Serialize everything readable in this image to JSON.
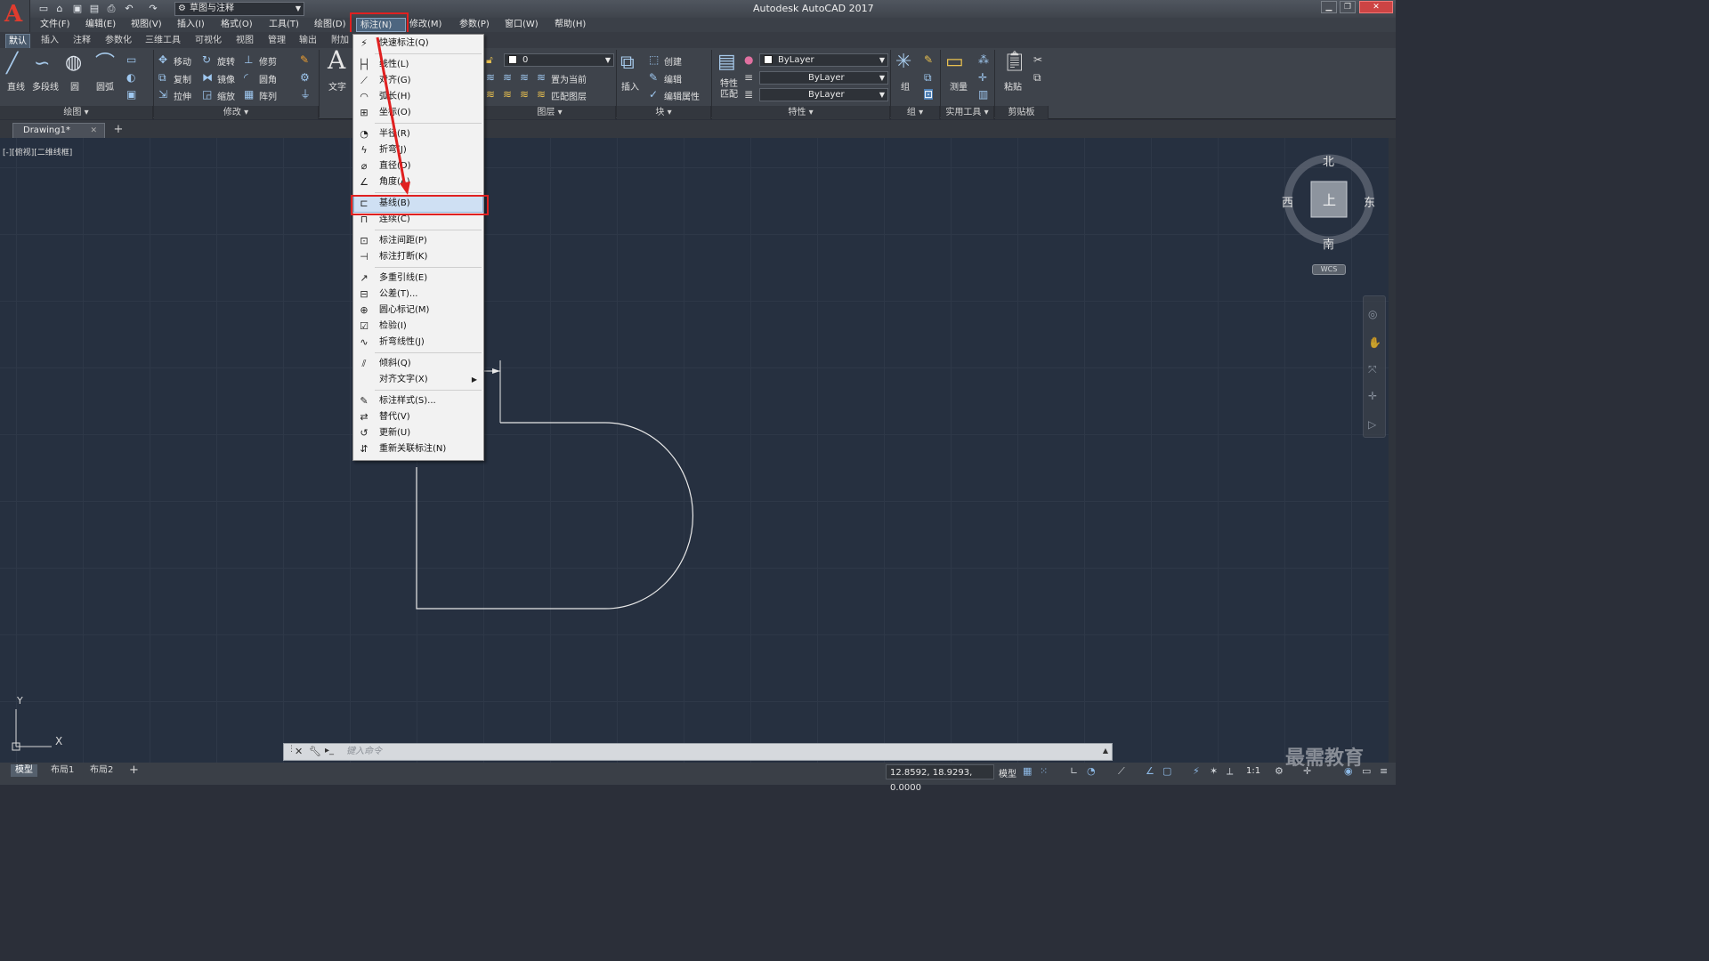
{
  "app": {
    "title": "Autodesk AutoCAD 2017",
    "workspace": "草图与注释"
  },
  "menubar": [
    {
      "id": "file",
      "label": "文件(F)"
    },
    {
      "id": "edit",
      "label": "编辑(E)"
    },
    {
      "id": "view",
      "label": "视图(V)"
    },
    {
      "id": "insert",
      "label": "插入(I)"
    },
    {
      "id": "format",
      "label": "格式(O)"
    },
    {
      "id": "tools",
      "label": "工具(T)"
    },
    {
      "id": "draw",
      "label": "绘图(D)"
    },
    {
      "id": "dimension",
      "label": "标注(N)"
    },
    {
      "id": "modify",
      "label": "修改(M)"
    },
    {
      "id": "parameters",
      "label": "参数(P)"
    },
    {
      "id": "window",
      "label": "窗口(W)"
    },
    {
      "id": "help",
      "label": "帮助(H)"
    }
  ],
  "ribbon_tabs": [
    "默认",
    "插入",
    "注释",
    "参数化",
    "三维工具",
    "可视化",
    "视图",
    "管理",
    "输出",
    "附加"
  ],
  "ribbon": {
    "draw": {
      "line": "直线",
      "polyline": "多段线",
      "circle": "圆",
      "arc": "圆弧",
      "panel": "绘图"
    },
    "modify": {
      "move": "移动",
      "rotate": "旋转",
      "trim": "修剪",
      "copy": "复制",
      "mirror": "镜像",
      "fillet": "圆角",
      "stretch": "拉伸",
      "scale": "缩放",
      "array": "阵列",
      "panel": "修改"
    },
    "annotation": {
      "text": "文字"
    },
    "layers": {
      "layer_value": "0",
      "set_current": "置为当前",
      "match_layer": "匹配图层",
      "panel": "图层"
    },
    "block": {
      "insert": "插入",
      "create": "创建",
      "edit": "编辑",
      "edit_attributes": "编辑属性",
      "panel": "块"
    },
    "properties": {
      "match_properties": "特性\n匹配",
      "color": "ByLayer",
      "linetype": "ByLayer",
      "lineweight": "ByLayer",
      "panel": "特性"
    },
    "groups": {
      "group": "组",
      "panel": "组"
    },
    "utilities": {
      "measure": "测量",
      "panel": "实用工具"
    },
    "clipboard": {
      "paste": "粘贴",
      "panel": "剪贴板"
    }
  },
  "document_tabs": [
    {
      "label": "Drawing1*"
    }
  ],
  "viewport_label": "[-][俯视][二维线框]",
  "viewcube": {
    "north": "北",
    "south": "南",
    "east": "东",
    "west": "西",
    "face": "上",
    "ucs": "WCS"
  },
  "dimension_menu": {
    "items": [
      {
        "label": "快速标注(Q)",
        "icon": "quick-dim-icon",
        "sep_before": false
      },
      {
        "label": "线性(L)",
        "icon": "linear-dim-icon",
        "sep_before": true
      },
      {
        "label": "对齐(G)",
        "icon": "aligned-dim-icon",
        "sep_before": false
      },
      {
        "label": "弧长(H)",
        "icon": "arc-length-icon",
        "sep_before": false
      },
      {
        "label": "坐标(O)",
        "icon": "ordinate-icon",
        "sep_before": false
      },
      {
        "label": "半径(R)",
        "icon": "radius-icon",
        "sep_before": true
      },
      {
        "label": "折弯(J)",
        "icon": "jogged-icon",
        "sep_before": false
      },
      {
        "label": "直径(D)",
        "icon": "diameter-icon",
        "sep_before": false
      },
      {
        "label": "角度(A)",
        "icon": "angular-icon",
        "sep_before": false
      },
      {
        "label": "基线(B)",
        "icon": "baseline-icon",
        "sep_before": true,
        "highlighted": true
      },
      {
        "label": "连续(C)",
        "icon": "continue-icon",
        "sep_before": false
      },
      {
        "label": "标注间距(P)",
        "icon": "dim-space-icon",
        "sep_before": true
      },
      {
        "label": "标注打断(K)",
        "icon": "dim-break-icon",
        "sep_before": false
      },
      {
        "label": "多重引线(E)",
        "icon": "mleader-icon",
        "sep_before": true
      },
      {
        "label": "公差(T)...",
        "icon": "tolerance-icon",
        "sep_before": false
      },
      {
        "label": "圆心标记(M)",
        "icon": "center-mark-icon",
        "sep_before": false
      },
      {
        "label": "检验(I)",
        "icon": "inspection-icon",
        "sep_before": false
      },
      {
        "label": "折弯线性(J)",
        "icon": "jogged-linear-icon",
        "sep_before": false
      },
      {
        "label": "倾斜(Q)",
        "icon": "oblique-icon",
        "sep_before": true
      },
      {
        "label": "对齐文字(X)",
        "icon": "",
        "sep_before": false,
        "submenu": true
      },
      {
        "label": "标注样式(S)...",
        "icon": "dim-style-icon",
        "sep_before": true
      },
      {
        "label": "替代(V)",
        "icon": "override-icon",
        "sep_before": false
      },
      {
        "label": "更新(U)",
        "icon": "update-icon",
        "sep_before": false
      },
      {
        "label": "重新关联标注(N)",
        "icon": "reassociate-icon",
        "sep_before": false
      }
    ]
  },
  "command_line": {
    "placeholder": "键入命令"
  },
  "layout_tabs": [
    "模型",
    "布局1",
    "布局2"
  ],
  "status": {
    "coordinates": "12.8592, 18.9293, 0.0000",
    "model": "模型",
    "scale": "1:1"
  },
  "ucs_axes": {
    "x": "X",
    "y": "Y"
  },
  "watermark": "最需教育",
  "colors": {
    "canvas": "#263040",
    "highlight": "#e02020",
    "accent": "#e03c2e"
  }
}
